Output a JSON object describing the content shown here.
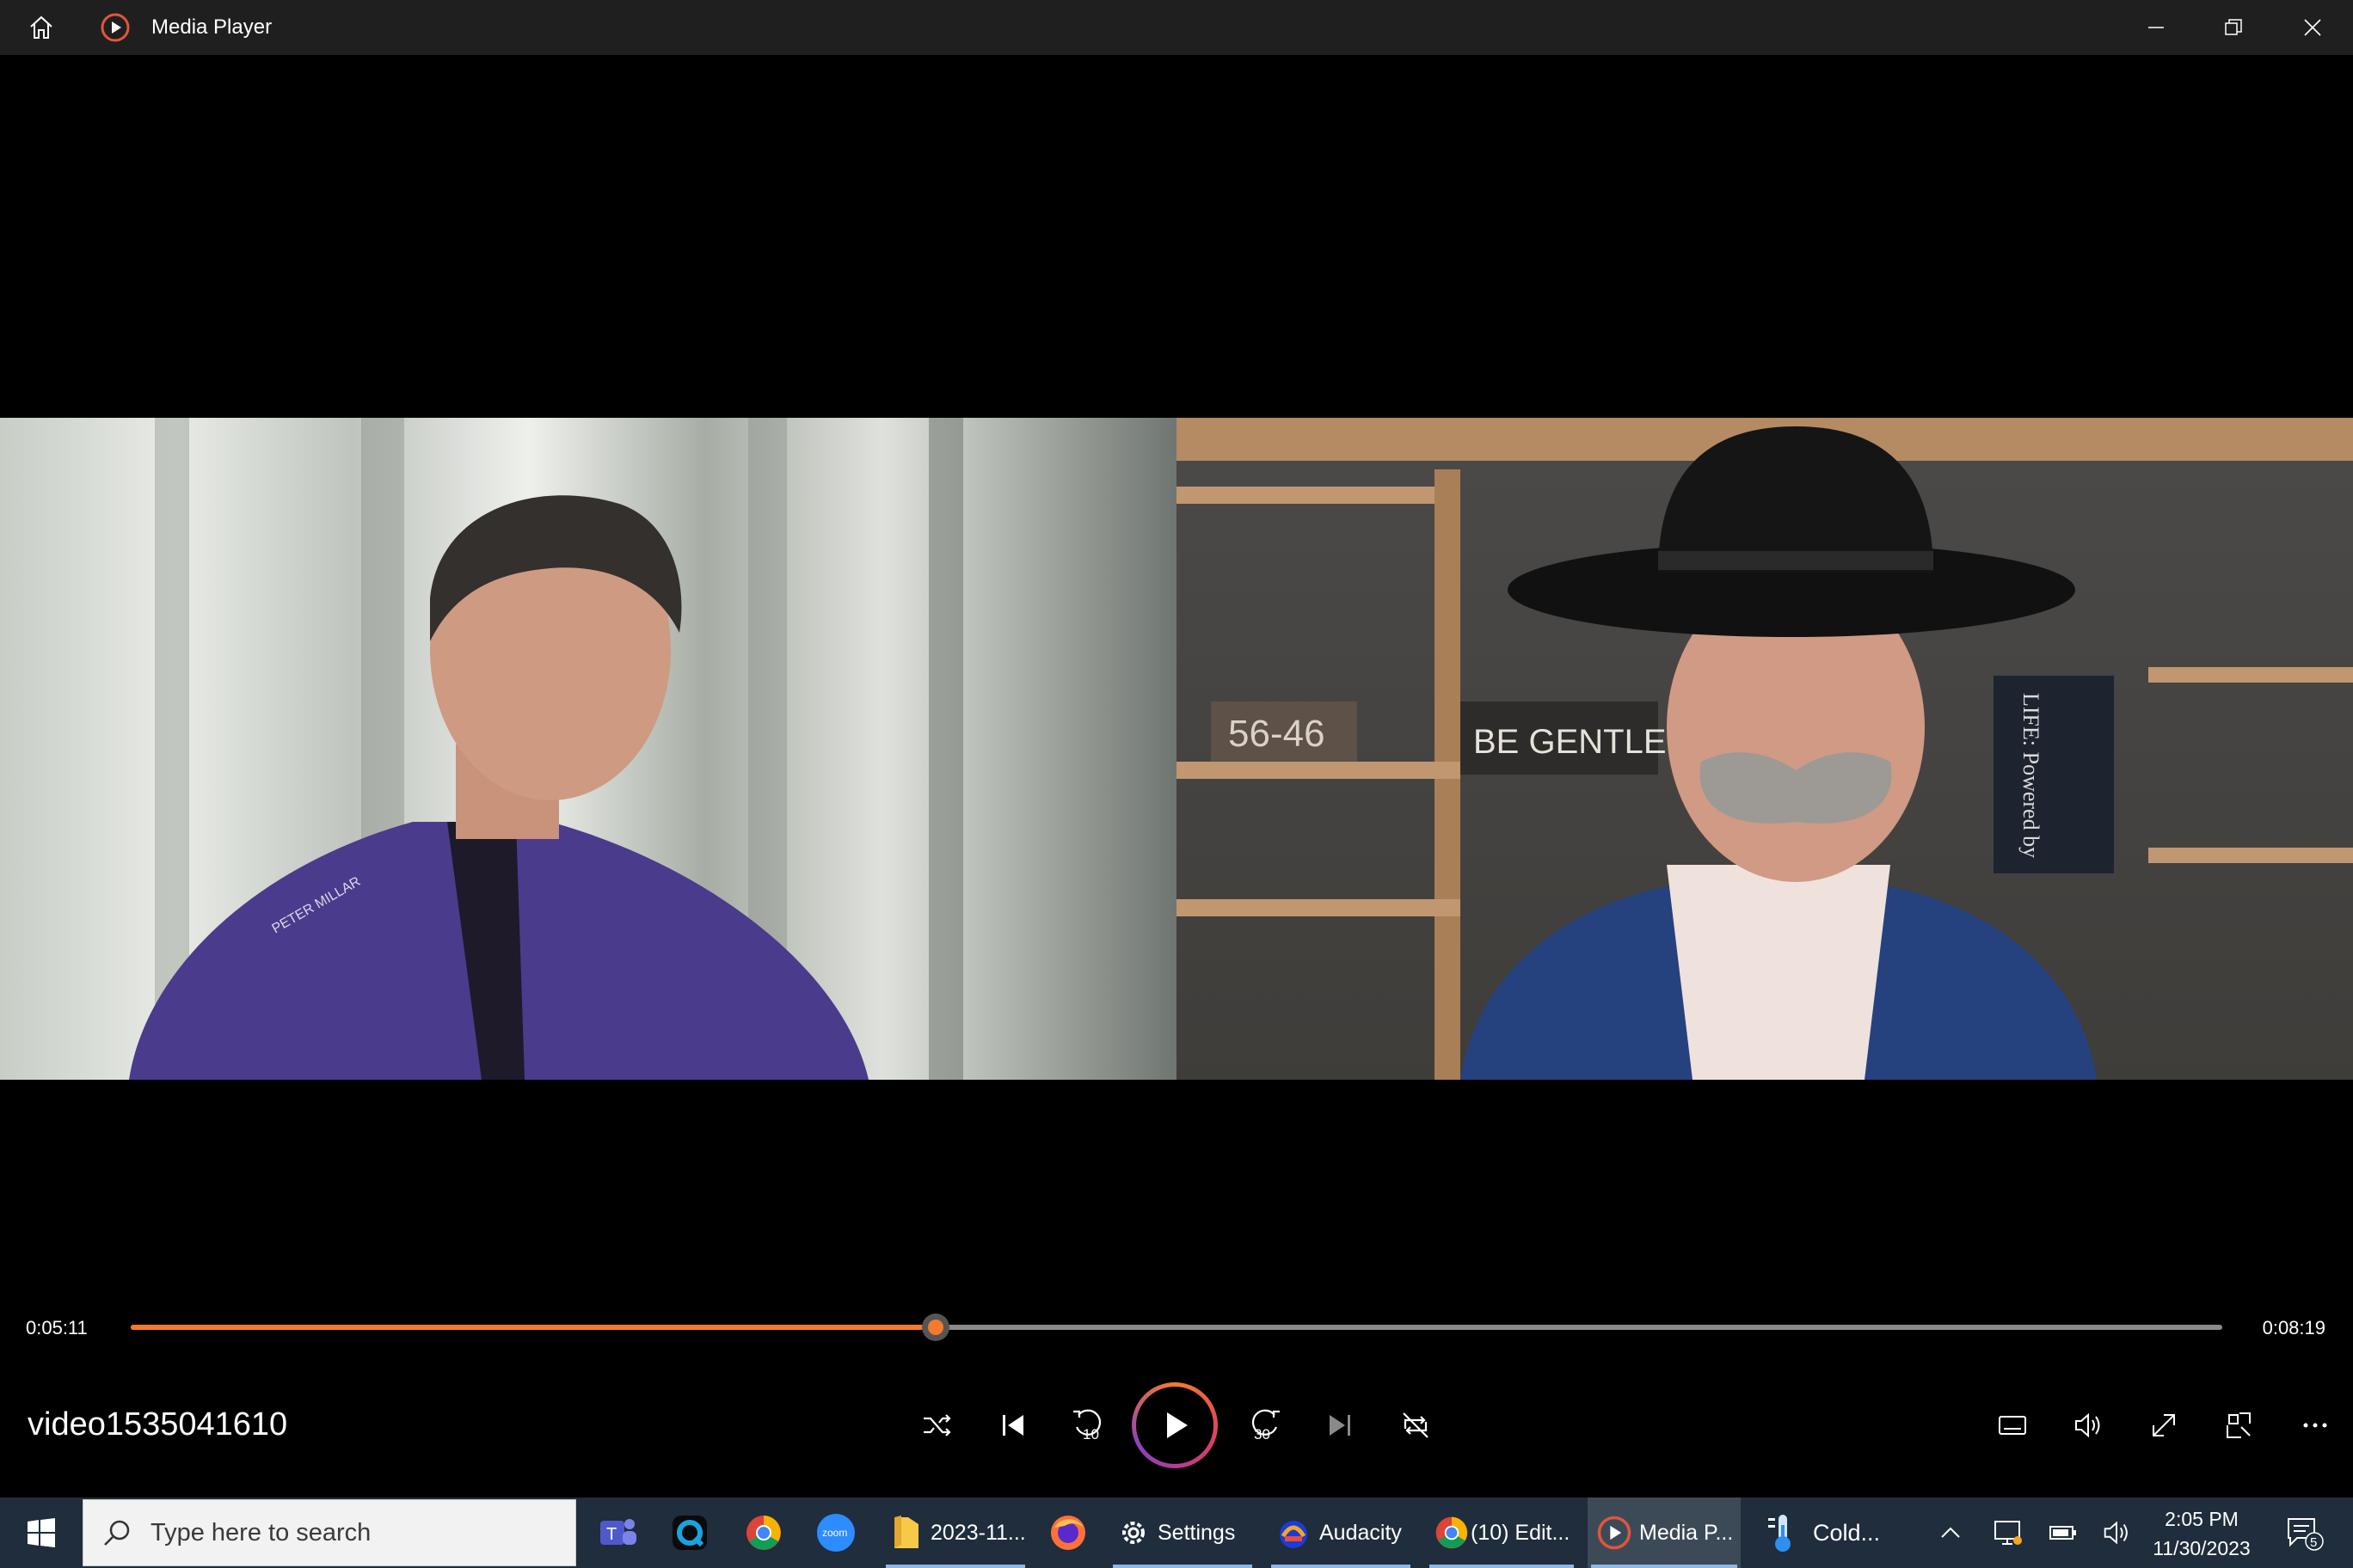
{
  "window": {
    "title": "Media Player",
    "accent_color": "#f57a2c"
  },
  "player": {
    "current_time": "0:05:11",
    "total_time": "0:08:19",
    "progress": 0.385,
    "video_name": "video1535041610",
    "skip_back_seconds": "10",
    "skip_forward_seconds": "30"
  },
  "video": {
    "left_sweater_text": "PETER MILLAR",
    "right_sign_text": "BE GENTLE ST.",
    "right_plate_text": "56-46",
    "right_flag_text": "LIFE: Powered by"
  },
  "taskbar": {
    "search_placeholder": "Type here to search",
    "items": [
      {
        "label": "",
        "icon": "teams-icon"
      },
      {
        "label": "",
        "icon": "quickassist-icon"
      },
      {
        "label": "",
        "icon": "chrome-icon"
      },
      {
        "label": "zoom",
        "icon": "zoom-icon"
      },
      {
        "label": "2023-11...",
        "icon": "folder-icon"
      },
      {
        "label": "",
        "icon": "firefox-icon"
      },
      {
        "label": "Settings",
        "icon": "gear-icon"
      },
      {
        "label": "Audacity",
        "icon": "audacity-icon"
      },
      {
        "label": "(10) Edit...",
        "icon": "chrome-icon"
      },
      {
        "label": "Media P...",
        "icon": "media-player-icon"
      },
      {
        "label": "Cold...",
        "icon": "thermometer-icon"
      }
    ],
    "time": "2:05 PM",
    "date": "11/30/2023",
    "notification_count": "5"
  }
}
